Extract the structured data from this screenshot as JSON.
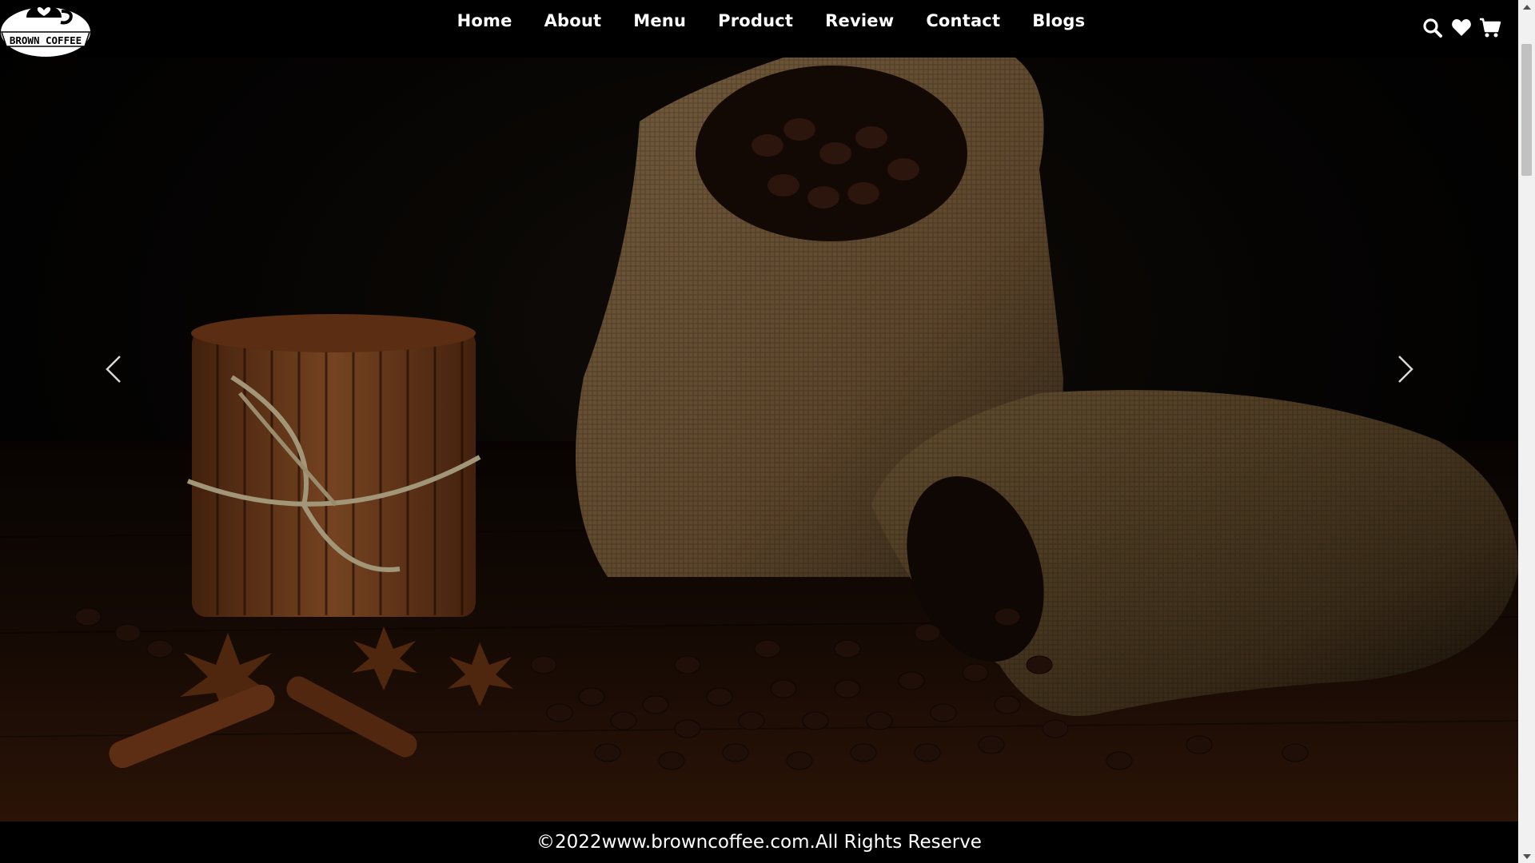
{
  "brand": {
    "logo_text": "BROWN COFFEE"
  },
  "nav": {
    "items": [
      "Home",
      "About",
      "Menu",
      "Product",
      "Review",
      "Contact",
      "Blogs"
    ]
  },
  "header_icons": [
    "search-icon",
    "heart-icon",
    "cart-icon"
  ],
  "carousel": {
    "prev_icon": "chevron-left-icon",
    "next_icon": "chevron-right-icon"
  },
  "footer": {
    "copyright": "©2022www.browncoffee.com.All Rights Reserve"
  },
  "colors": {
    "header_bg": "#000000",
    "text": "#ffffff",
    "burlap": "#8a6a42",
    "cinnamon": "#8b4a22",
    "bean": "#2a1610"
  }
}
